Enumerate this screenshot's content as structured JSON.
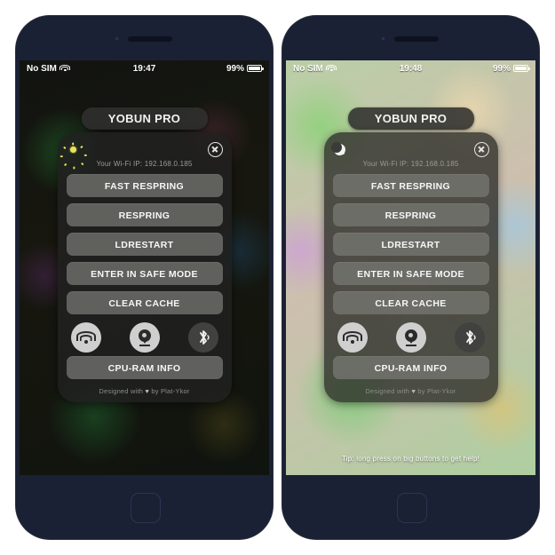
{
  "app": {
    "title": "YOBUN PRO"
  },
  "phones": [
    {
      "id": "left",
      "theme": "dark",
      "status": {
        "carrier": "No SIM",
        "time": "19:47",
        "battery": "99%"
      },
      "panel": {
        "mode_icon": "sun-icon",
        "close_icon": "close-icon",
        "ip_label": "Your Wi-Fi IP: 192.168.0.185",
        "buttons": [
          "FAST RESPRING",
          "RESPRING",
          "LDRESTART",
          "ENTER IN SAFE MODE",
          "CLEAR CACHE"
        ],
        "toggles": [
          {
            "name": "wifi-toggle",
            "icon": "wifi-icon",
            "state": "on"
          },
          {
            "name": "location-toggle",
            "icon": "location-pin-icon",
            "state": "on"
          },
          {
            "name": "bluetooth-toggle",
            "icon": "bluetooth-icon",
            "state": "off"
          }
        ],
        "info_button": "CPU-RAM INFO",
        "credit_prefix": "Designed with",
        "credit_heart": "♥",
        "credit_suffix": "by Plat-Ykor"
      },
      "tip": ""
    },
    {
      "id": "right",
      "theme": "light",
      "status": {
        "carrier": "No SIM",
        "time": "19:48",
        "battery": "99%"
      },
      "panel": {
        "mode_icon": "moon-icon",
        "close_icon": "close-icon",
        "ip_label": "Your Wi-Fi IP: 192.168.0.185",
        "buttons": [
          "FAST RESPRING",
          "RESPRING",
          "LDRESTART",
          "ENTER IN SAFE MODE",
          "CLEAR CACHE"
        ],
        "toggles": [
          {
            "name": "wifi-toggle",
            "icon": "wifi-icon",
            "state": "on"
          },
          {
            "name": "location-toggle",
            "icon": "location-pin-icon",
            "state": "on"
          },
          {
            "name": "bluetooth-toggle",
            "icon": "bluetooth-icon",
            "state": "off"
          }
        ],
        "info_button": "CPU-RAM INFO",
        "credit_prefix": "Designed with",
        "credit_heart": "♥",
        "credit_suffix": "by Plat-Ykor"
      },
      "tip": "Tip: long press on big buttons to get help!"
    }
  ],
  "colors": {
    "bezel": "#1b2135",
    "panel_bg": "#21211f",
    "button_bg": "#7a7a76",
    "toggle_on": "#cfcfcf",
    "toggle_off": "#414140",
    "sun": "#e8e55a",
    "page_bg": "#ffffff"
  }
}
